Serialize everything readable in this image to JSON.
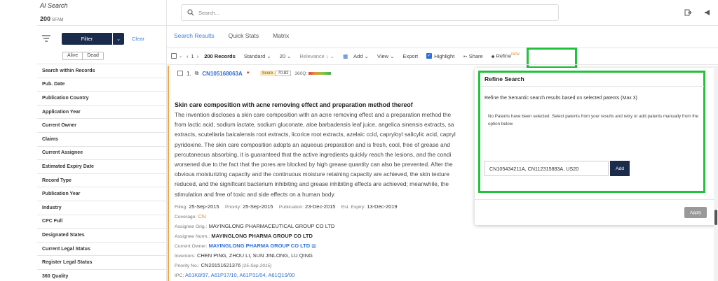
{
  "sidebar": {
    "title": "AI Search",
    "count": "200",
    "count_unit": "SFAM",
    "filter_label": "Filter",
    "clear_label": "Clear",
    "alive_label": "Alive",
    "dead_label": "Dead",
    "facets": [
      "Search within Records",
      "Pub. Date",
      "Publication Country",
      "Application Year",
      "Current Owner",
      "Claims",
      "Current Assignee",
      "Estimated Expiry Date",
      "Record Type",
      "Publication Year",
      "Industry",
      "CPC Full",
      "Designated States",
      "Current Legal Status",
      "Register Legal Status",
      "360 Quality"
    ]
  },
  "search": {
    "placeholder": "Search..."
  },
  "tabs": [
    "Search Results",
    "Quick Stats",
    "Matrix"
  ],
  "toolbar": {
    "page": "1",
    "records": "200 Records",
    "view_mode": "Standard",
    "per_page": "20",
    "sort": "Relevance",
    "add": "Add",
    "view": "View",
    "export": "Export",
    "highlight": "Highlight",
    "share": "Share",
    "refine": "Refine",
    "new_tag": "NEW"
  },
  "record": {
    "index": "1.",
    "number": "CN105168063A",
    "score_label": "Score",
    "score_value": "70.82",
    "q360_label": "360Q:",
    "title": "Skin care composition with acne removing effect and preparation method thereof",
    "abstract_lines": [
      "The invention discloses a skin care composition with an acne removing effect and a preparation method the",
      "from lactic acid, sodium lactate, sodium gluconate, aloe barbadensis leaf juice, angelica sinensis extracts, sa",
      "extracts, scutellaria baicalensis root extracts, licorice root extracts, azelaic ccid, capryloyl salicylic acid, capryl",
      "pyridoxine. The skin care composition adopts an aqueous preparation and is fresh, cool, free of grease and",
      "percutaneous absorbing, it is guaranteed that the active ingredients quickly reach the lesions, and the condi",
      "worsened due to the fact that the pores are blocked by high grease quantity can also be prevented. After the",
      "obvious moisturizing capacity and the continuous moisture retaining capacity are achieved, the skin texture",
      "reduced, and the significant bacterium inhibiting and grease inhibiting effects are achieved; meanwhile, the",
      "stimulation and free of toxic and side effects on a human body."
    ],
    "filing_label": "Filing:",
    "filing": "25-Sep-2015",
    "priority_label": "Priority:",
    "priority": "25-Sep-2015",
    "publication_label": "Publication:",
    "publication": "23-Dec-2015",
    "expiry_label": "Est. Expiry:",
    "expiry": "13-Dec-2019",
    "coverage_label": "Coverage:",
    "coverage": "CN",
    "assignee_orig_label": "Assignee Orig.:",
    "assignee_orig": "MAYINGLONG PHARMACEUTICAL GROUP CO LTD",
    "assignee_norm_label": "Assignee Norm.:",
    "assignee_norm": "MAYINGLONG PHARMA GROUP CO LTD",
    "current_owner_label": "Current Owner:",
    "current_owner": "MAYINGLONG PHARMA GROUP CO LTD",
    "inventors_label": "Inventors:",
    "inventors": "CHEN PING, ZHOU LI, SUN JINLONG, LU QING",
    "priority_no_label": "Priority No.:",
    "priority_no": "CN20151621376",
    "priority_no_date": "(25-Sep-2015)",
    "ipc_label": "IPC:",
    "ipc": [
      "A61K8/97,",
      "A61P17/10,",
      "A61P31/04,",
      "A61Q19/00"
    ]
  },
  "refine_panel": {
    "title": "Refine Search",
    "subtitle": "Refine the Semantic search results based on selected patents (Max 3)",
    "message": "No Patents have been selected. Select patents from your results and retry or add patents manually from the option below",
    "input_value": "CN105434211A, CN112315883A, US20",
    "add_label": "Add",
    "apply_label": "Apply"
  },
  "colors": {
    "navy": "#1a2b4c",
    "link_blue": "#2f6fd6",
    "highlight_green": "#22c13a",
    "accent_orange": "#f0a64a"
  }
}
